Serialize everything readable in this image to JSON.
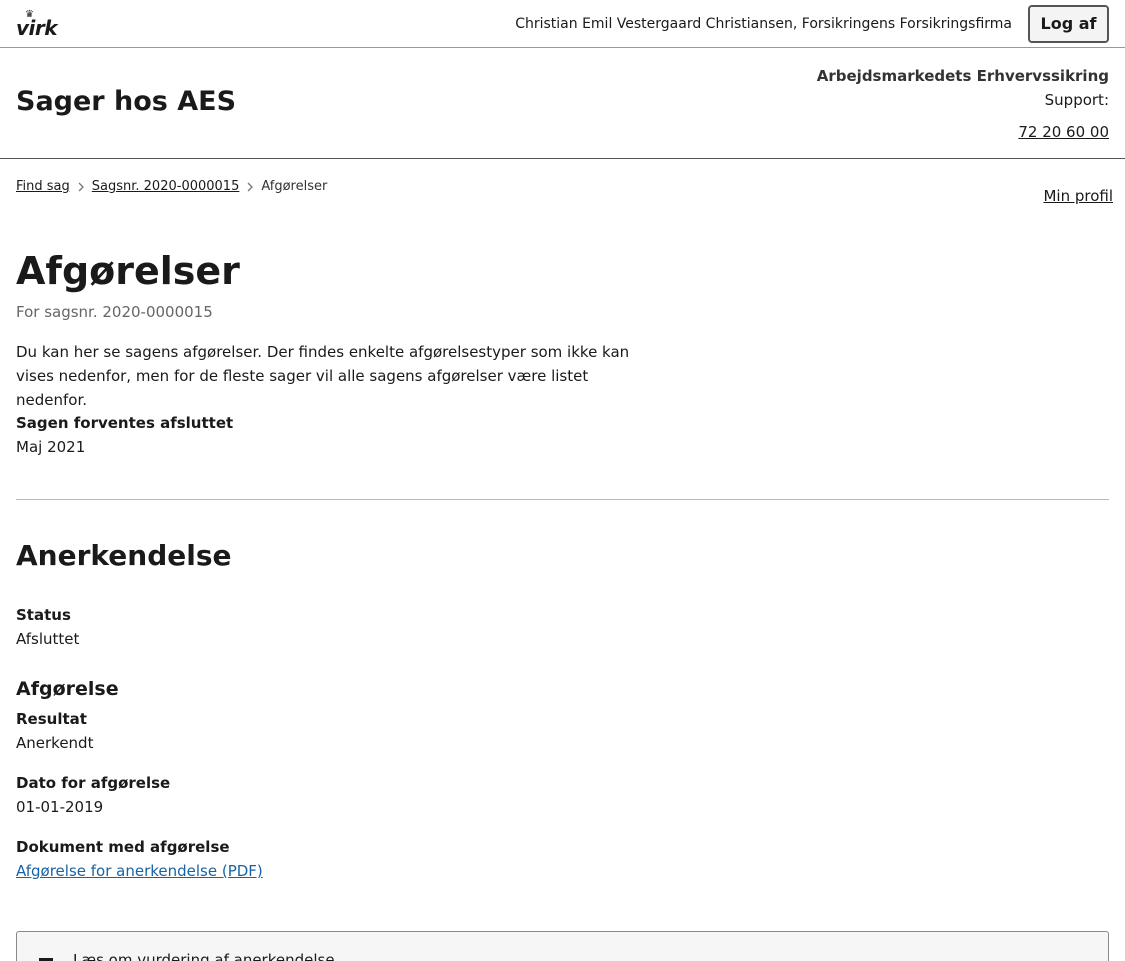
{
  "topbar": {
    "logo_text": "virk",
    "logo_crown": "♛",
    "user": "Christian Emil Vestergaard Christiansen, Forsikringens Forsikringsfirma",
    "logout_label": "Log af"
  },
  "header": {
    "app_title": "Sager hos AES",
    "org_name": "Arbejdsmarkedets Erhvervssikring",
    "support_label": "Support:",
    "support_phone": "72 20 60 00"
  },
  "breadcrumb": {
    "items": [
      {
        "label": "Find sag"
      },
      {
        "label": "Sagsnr. 2020-0000015"
      },
      {
        "label": "Afgørelser"
      }
    ]
  },
  "profile_link": "Min profil",
  "page": {
    "title": "Afgørelser",
    "subtitle": "For sagsnr. 2020-0000015",
    "intro": "Du kan her se sagens afgørelser. Der findes enkelte afgørelsestyper som ikke kan vises nedenfor, men for de fleste sager vil alle sagens afgørelser være listet nedenfor.",
    "expected_label": "Sagen forventes afsluttet",
    "expected_value": "Maj 2021"
  },
  "section": {
    "title": "Anerkendelse",
    "status_label": "Status",
    "status_value": "Afsluttet",
    "decision_heading": "Afgørelse",
    "result_label": "Resultat",
    "result_value": "Anerkendt",
    "date_label": "Dato for afgørelse",
    "date_value": "01-01-2019",
    "document_label": "Dokument med afgørelse",
    "document_link": "Afgørelse for anerkendelse (PDF)",
    "accordion_label": "Læs om vurdering af anerkendelse"
  },
  "colors": {
    "link": "#1763a6",
    "text": "#1a1a1a",
    "muted": "#666666"
  }
}
